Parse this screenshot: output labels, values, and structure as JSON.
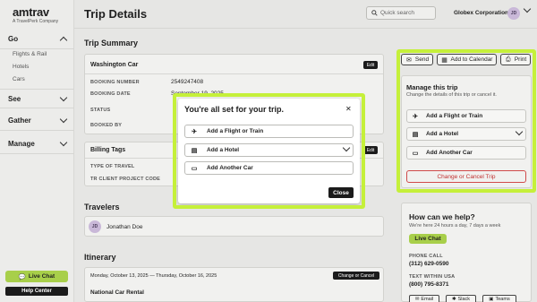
{
  "brand": {
    "name": "amtrav",
    "sub": "A TravelPerk Company"
  },
  "sidebar": {
    "sections": [
      {
        "label": "Go",
        "items": [
          "Flights & Rail",
          "Hotels",
          "Cars"
        ]
      },
      {
        "label": "See"
      },
      {
        "label": "Gather"
      },
      {
        "label": "Manage"
      }
    ],
    "live_chat": "Live Chat",
    "help_center": "Help Center"
  },
  "header": {
    "title": "Trip Details",
    "search_placeholder": "Quick search",
    "org": "Globex Corporation",
    "avatar": "JD"
  },
  "summary": {
    "heading": "Trip Summary",
    "car_title": "Washington Car",
    "edit": "Edit",
    "booking_number_label": "BOOKING NUMBER",
    "booking_number": "2549247408",
    "booking_date_label": "BOOKING DATE",
    "booking_date": "September 19, 2025",
    "status_label": "STATUS",
    "booked_by_label": "BOOKED BY"
  },
  "billing": {
    "heading": "Billing Tags",
    "edit": "Edit",
    "type_label": "TYPE OF TRAVEL",
    "project_label": "TR CLIENT PROJECT CODE"
  },
  "travelers": {
    "heading": "Travelers",
    "initials": "JD",
    "name": "Jonathan Doe"
  },
  "itinerary": {
    "heading": "Itinerary",
    "dates": "Monday, October 13, 2025 — Thursday, October 16, 2025",
    "change": "Change or Cancel",
    "item": "National Car Rental"
  },
  "actions": {
    "send": "Send",
    "calendar": "Add to Calendar",
    "print": "Print"
  },
  "manage": {
    "title": "Manage this trip",
    "subtitle": "Change the details of this trip or cancel it.",
    "flight": "Add a Flight or Train",
    "hotel": "Add a Hotel",
    "car": "Add Another Car",
    "cancel": "Change or Cancel Trip"
  },
  "help": {
    "title": "How can we help?",
    "subtitle": "We're here 24 hours a day, 7 days a week",
    "live_chat": "Live Chat",
    "phone_label": "PHONE CALL",
    "phone": "(312) 629-0590",
    "text_label": "TEXT WITHIN USA",
    "text": "(800) 795-8371",
    "email": "Email",
    "slack": "Slack",
    "teams": "Teams"
  },
  "modal": {
    "title": "You're all set for your trip.",
    "flight": "Add a Flight or Train",
    "hotel": "Add a Hotel",
    "car": "Add Another Car",
    "close": "Close"
  },
  "colors": {
    "highlight": "#c5f03a",
    "accent_green": "#a8cf4a",
    "danger": "#c03030"
  }
}
